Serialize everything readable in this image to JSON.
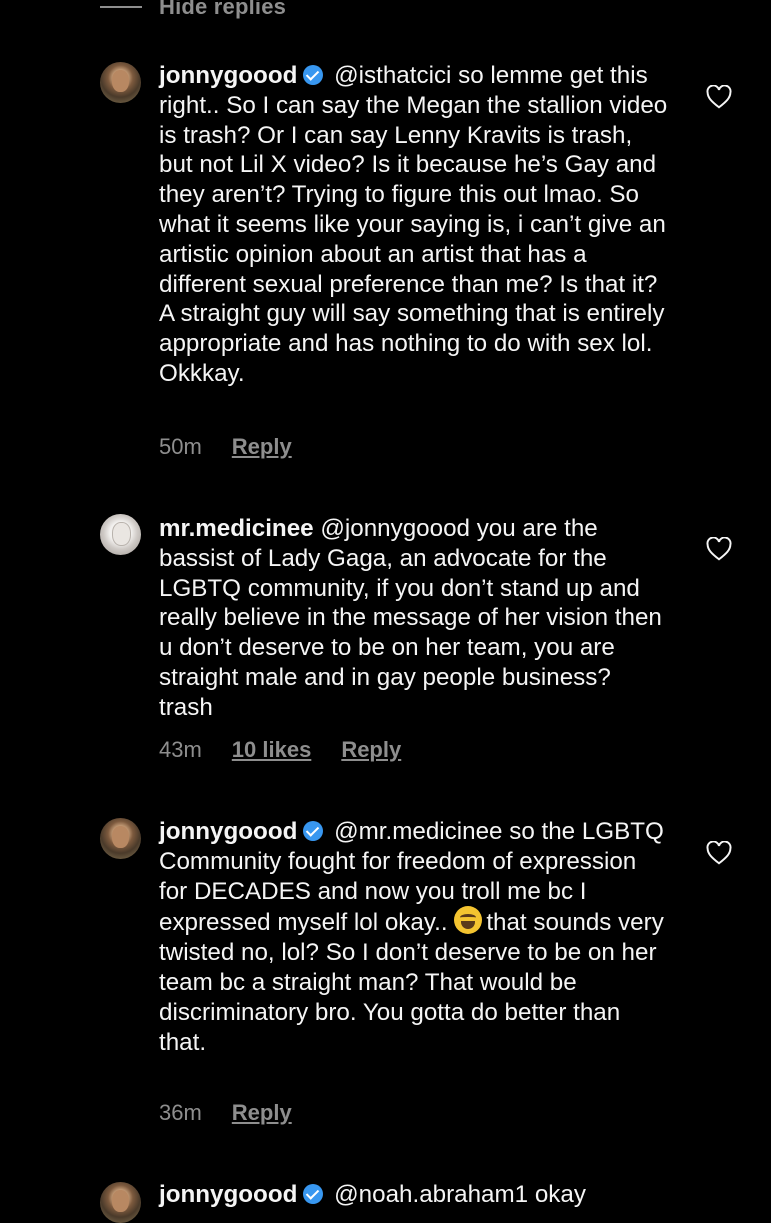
{
  "hide_replies": "Hide replies",
  "comments": [
    {
      "username": "jonnygoood",
      "text": "@isthatcici so lemme get this right.. So I can say the Megan the stallion video is trash? Or I can say Lenny Kravits is trash, but not Lil X  video? Is it because he’s Gay and they aren’t? Trying to figure this out lmao. So what it seems like your saying is, i can’t give an artistic opinion about an artist that has a different sexual preference than me? Is that it? A straight guy will say something that is entirely appropriate and has nothing to do with sex lol. Okkkay.",
      "time": "50m",
      "reply": "Reply"
    },
    {
      "username": "mr.medicinee",
      "text": "@jonnygoood you are the bassist of Lady Gaga, an advocate for the LGBTQ community, if you don’t stand up and really believe in the message of her vision then u don’t deserve to be on her team, you are straight male and in gay people business? trash",
      "time": "43m",
      "likes": "10 likes",
      "reply": "Reply"
    },
    {
      "username": "jonnygoood",
      "text_before_emoji": "@mr.medicinee so the LGBTQ Community fought for freedom of expression for DECADES and now you troll me bc I expressed myself lol okay..",
      "emoji": "face-with-tears-of-joy",
      "text_after_emoji": "that sounds very twisted no, lol? So I don’t deserve to be on her team bc a straight man? That would be discriminatory bro. You gotta do better than that.",
      "time": "36m",
      "reply": "Reply"
    },
    {
      "username": "jonnygoood",
      "text": "@noah.abraham1 okay"
    }
  ]
}
